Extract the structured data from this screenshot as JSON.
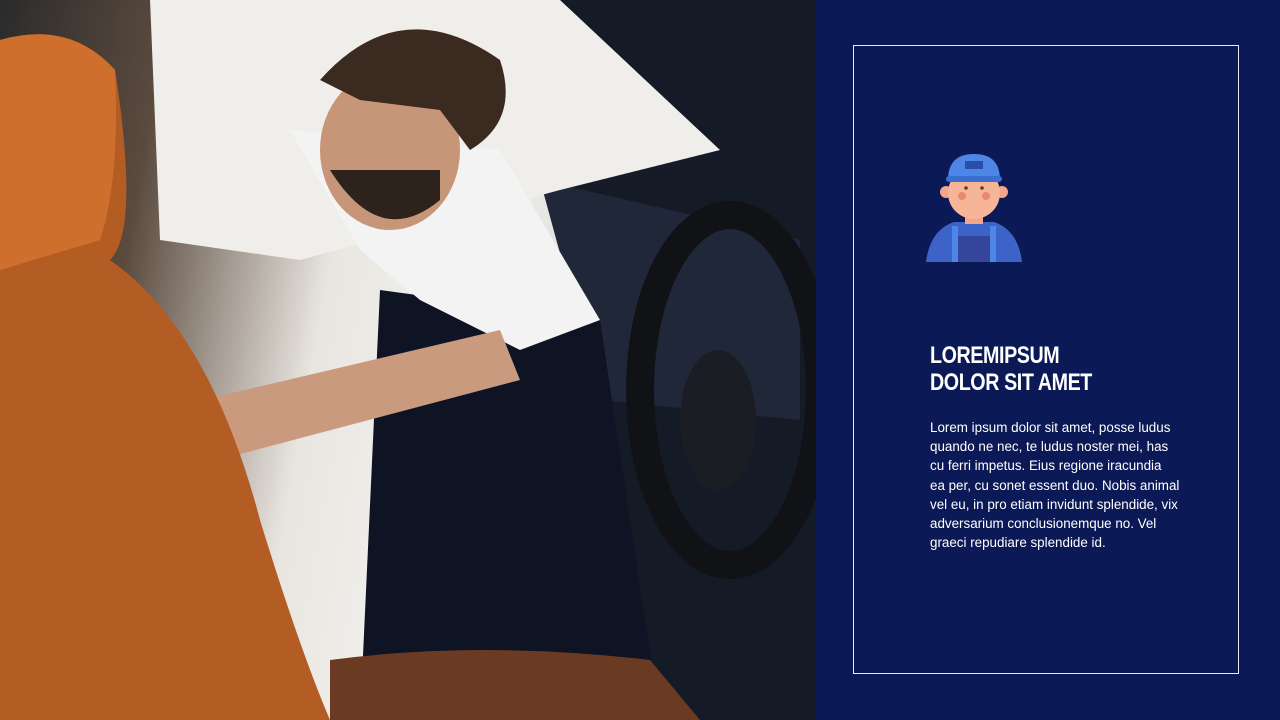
{
  "slide": {
    "title_line1": "LOREMIPSUM",
    "title_line2": "DOLOR SIT AMET",
    "body": "Lorem ipsum dolor sit amet, posse ludus quando ne nec, te ludus noster mei, has cu ferri impetus. Eius regione iracundia ea per, cu sonet essent duo. Nobis animal vel eu, in pro etiam invidunt splendide, vix adversarium conclusionemque no. Vel graeci repudiare splendide id.",
    "icon": "mechanic-worker-icon"
  },
  "colors": {
    "panel_background": "#0b1a56",
    "frame_border": "#e9ecf6",
    "cap_blue": "#4d86e6",
    "overall_blue": "#3d63c9"
  }
}
